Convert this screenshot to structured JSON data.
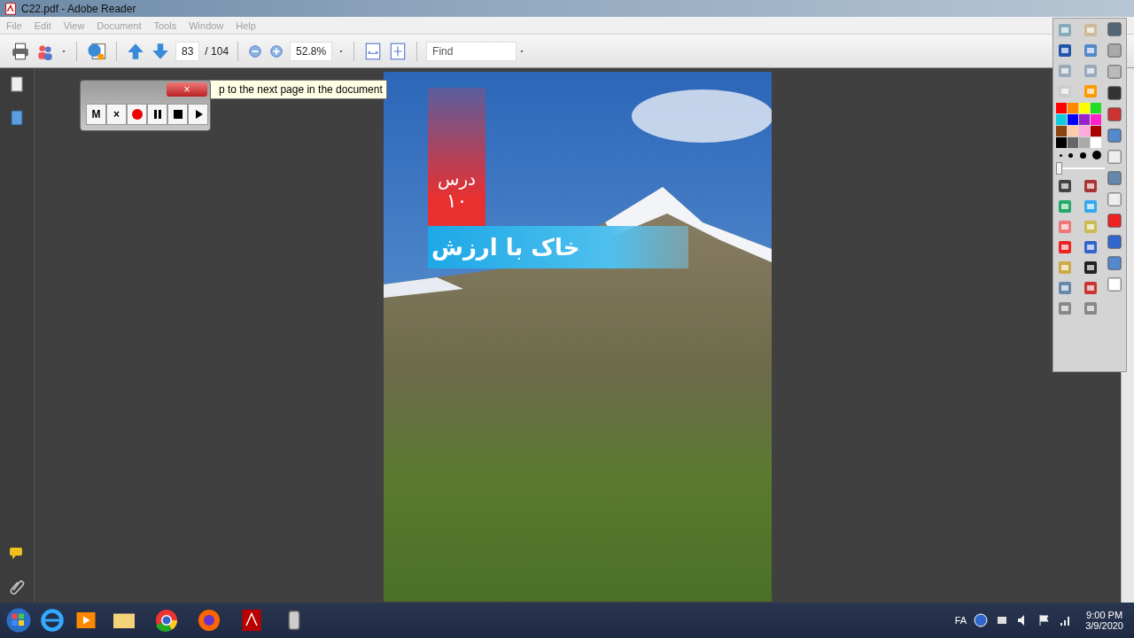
{
  "window": {
    "title": "C22.pdf - Adobe Reader"
  },
  "menu": [
    {
      "label": "File"
    },
    {
      "label": "Edit"
    },
    {
      "label": "View"
    },
    {
      "label": "Document"
    },
    {
      "label": "Tools"
    },
    {
      "label": "Window"
    },
    {
      "label": "Help"
    }
  ],
  "toolbar": {
    "page_number": "83",
    "page_total": "/ 104",
    "zoom": "52.8%",
    "find": {
      "placeholder": "Find"
    }
  },
  "tooltip": "p to the next page in the document",
  "recorder": {
    "keys": [
      "M",
      "×"
    ]
  },
  "page": {
    "lesson_label": "درس",
    "lesson_number": "۱۰",
    "title": "خاک با ارزش"
  },
  "pen_toolbar": {
    "palette": [
      {
        "color": "#ff0000"
      },
      {
        "color": "#ff8800"
      },
      {
        "color": "#ffff00"
      },
      {
        "color": "#22dd22"
      },
      {
        "color": "#11ccdd"
      },
      {
        "color": "#0000ff"
      },
      {
        "color": "#9922cc"
      },
      {
        "color": "#ff22cc"
      },
      {
        "color": "#884411"
      },
      {
        "color": "#ffccaa"
      },
      {
        "color": "#ffaadd"
      },
      {
        "color": "#aa0000"
      },
      {
        "color": "#000000"
      },
      {
        "color": "#666666"
      },
      {
        "color": "#aaaaaa"
      },
      {
        "color": "#ffffff"
      }
    ],
    "thickness": {
      "level": 0
    }
  },
  "taskbar": {
    "language": "FA",
    "time": "9:00 PM",
    "date": "3/9/2020"
  }
}
